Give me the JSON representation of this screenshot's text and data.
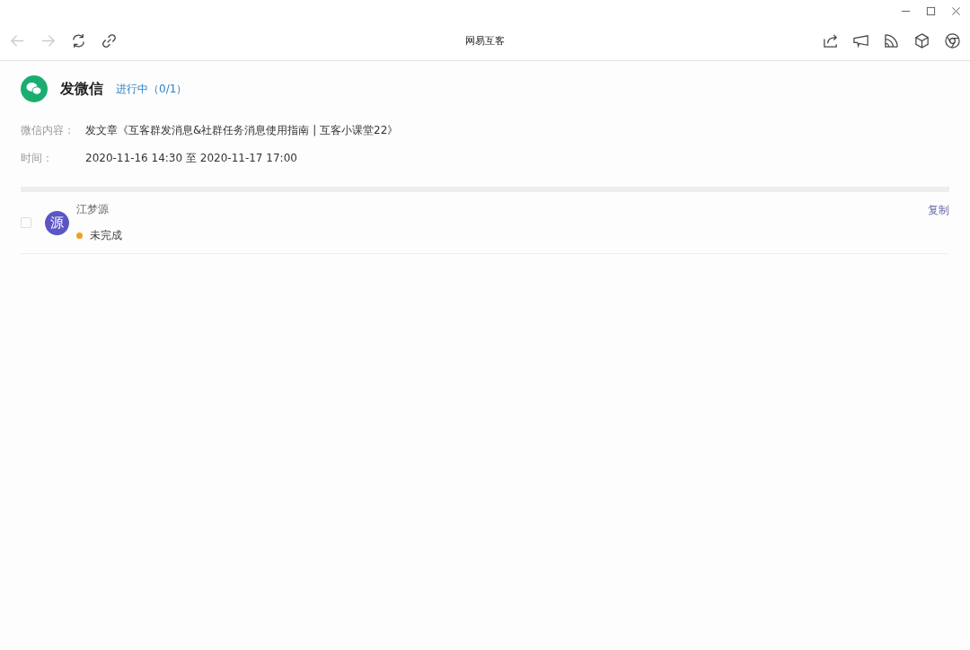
{
  "window": {
    "title": "网易互客"
  },
  "task": {
    "title": "发微信",
    "status": "进行中（0/1）"
  },
  "fields": [
    {
      "label": "微信内容：",
      "value": "发文章《互客群发消息&社群任务消息使用指南 | 互客小课堂22》"
    },
    {
      "label": "时间：",
      "value": "2020-11-16 14:30 至 2020-11-17 17:00"
    }
  ],
  "members": [
    {
      "checked": false,
      "avatar": "源",
      "name": "江梦源",
      "status": "未完成",
      "color": "#f0a020",
      "action": "复制"
    }
  ]
}
